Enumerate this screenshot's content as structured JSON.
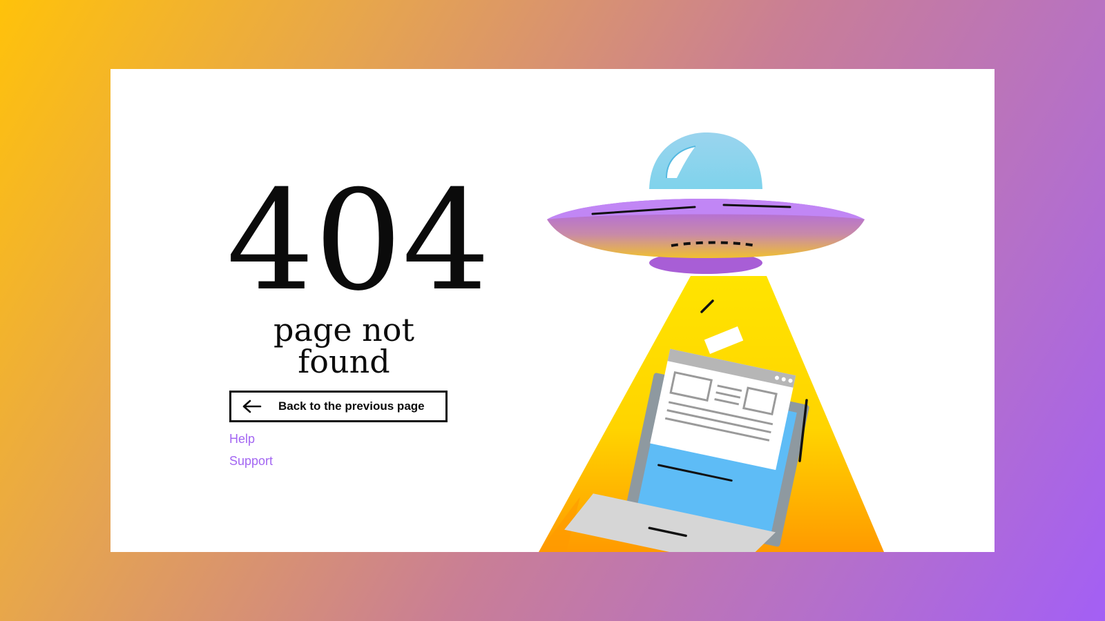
{
  "error": {
    "code": "404",
    "message": "page not found"
  },
  "actions": {
    "back_label": "Back to the previous page",
    "back_icon": "arrow-left-icon"
  },
  "links": {
    "help": "Help",
    "support": "Support"
  },
  "illustration": {
    "subject": "ufo-abducting-laptop"
  },
  "colors": {
    "link": "#a366f2",
    "text": "#0b0b0b",
    "ufo": "#b076f5",
    "beam": "#ffd60a",
    "screen": "#5ebcf6"
  }
}
